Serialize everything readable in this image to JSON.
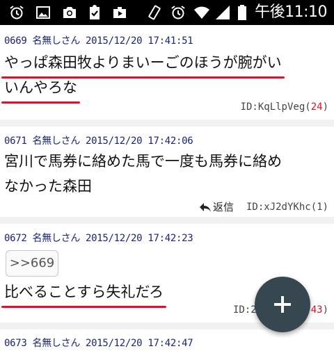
{
  "status_bar": {
    "time": "午後11:10",
    "left_icons": [
      "alarm-icon",
      "image-icon",
      "camera-icon",
      "clipboard-check-icon",
      "briefcase-play-icon"
    ],
    "right_icons": [
      "vibrate-icon",
      "alarm-icon",
      "wifi-icon",
      "signal-icon",
      "battery-icon"
    ]
  },
  "posts": [
    {
      "number": "0669",
      "name": "名無しさん",
      "date": "2015/12/20",
      "time": "17:41:51",
      "body_lines": [
        "やっぱ森田牧よりまいーごのほうが腕がい",
        "いんやろな"
      ],
      "id_label": "ID:KqLlpVeg(",
      "id_count": "24",
      "id_close": ")"
    },
    {
      "number": "0671",
      "name": "名無しさん",
      "date": "2015/12/20",
      "time": "17:42:06",
      "body_lines": [
        "宮川で馬券に絡めた馬で一度も馬券に絡め",
        "なかった森田"
      ],
      "reply_label": "返信",
      "id_label": "ID:xJ2dYKhc(1)"
    },
    {
      "number": "0672",
      "name": "名無しさん",
      "date": "2015/12/20",
      "time": "17:42:23",
      "anchor": ">>669",
      "body_lines": [
        "比べることすら失礼だろ"
      ],
      "id_label": "ID:2",
      "id_count": "43",
      "id_close": ")"
    },
    {
      "number": "0673",
      "name": "名無しさん",
      "date": "2015/12/20",
      "time": "17:42:47"
    }
  ],
  "colors": {
    "accent_red": "#e0102a",
    "header_blue": "#1a237e",
    "fab": "#37474f"
  },
  "fab": {
    "icon": "plus-icon"
  }
}
